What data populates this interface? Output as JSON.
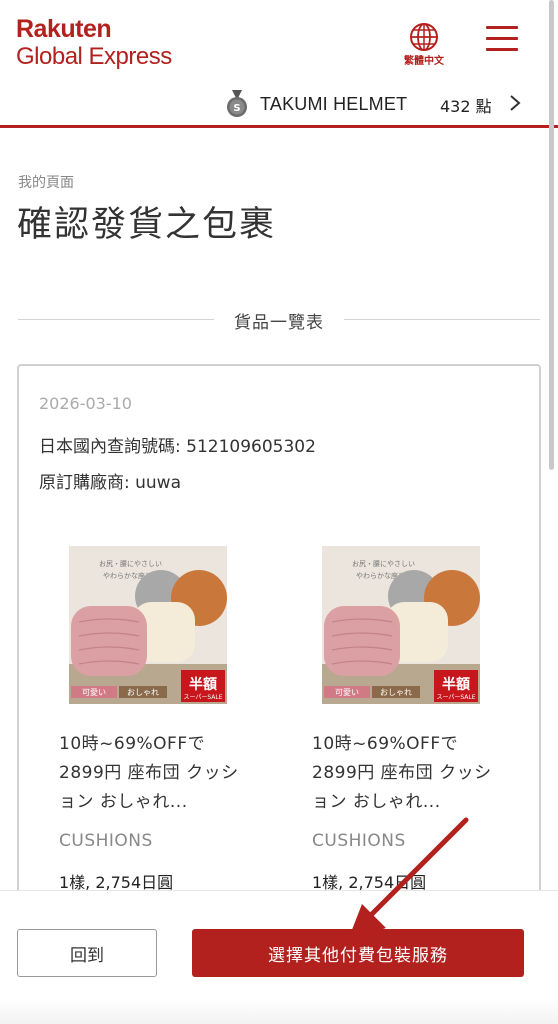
{
  "brand": {
    "line1": "Rakuten",
    "line2": "Global Express",
    "accent": "#b3211e"
  },
  "header": {
    "language_label": "繁體中文",
    "language_icon": "globe-icon",
    "menu_icon": "hamburger-menu-icon",
    "user_name": "TAKUMI HELMET",
    "user_badge_icon": "medal-icon",
    "points": "432 點"
  },
  "page": {
    "breadcrumb": "我的頁面",
    "title": "確認發貨之包裹",
    "section_label": "貨品一覽表"
  },
  "package": {
    "date": "2026-03-10",
    "tracking": "日本國內查詢號碼: 512109605302",
    "vendor": "原訂購廠商: uuwa",
    "products": [
      {
        "name": "10時~69%OFFで2899円 座布団 クッション おしゃれ...",
        "category": "CUSHIONS",
        "qty_price": "1樣,  2,754日圓",
        "image_tagline_1": "お尻・腰にやさしい",
        "image_tagline_2": "やわらかな座り心地",
        "image_badge_1": "可愛い",
        "image_badge_2": "おしゃれ",
        "image_sale_1": "半額",
        "image_sale_2": "スーパーSALE"
      },
      {
        "name": "10時~69%OFFで2899円 座布団 クッション おしゃれ...",
        "category": "CUSHIONS",
        "qty_price": "1樣,  2,754日圓",
        "image_tagline_1": "お尻・腰にやさしい",
        "image_tagline_2": "やわらかな座り心地",
        "image_badge_1": "可愛い",
        "image_badge_2": "おしゃれ",
        "image_sale_1": "半額",
        "image_sale_2": "スーパーSALE"
      }
    ]
  },
  "footer": {
    "back_label": "回到",
    "primary_label": "選擇其他付費包裝服務"
  }
}
